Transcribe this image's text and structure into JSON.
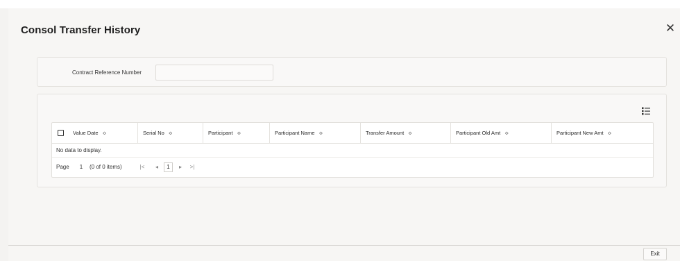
{
  "title": "Consol Transfer History",
  "close_icon": "close-icon",
  "contract": {
    "label": "Contract Reference Number",
    "value": ""
  },
  "grid": {
    "columns": [
      "Value Date",
      "Serial No",
      "Participant",
      "Participant Name",
      "Transfer Amount",
      "Participant Old Amt",
      "Participant New Amt"
    ],
    "no_data": "No data to display.",
    "pager": {
      "page_label": "Page",
      "page_value": "1",
      "items_info": "(0 of 0 items)",
      "current_page": "1",
      "first_icon": "first-page-icon",
      "prev_icon": "prev-page-icon",
      "next_icon": "next-page-icon",
      "last_icon": "last-page-icon"
    }
  },
  "footer": {
    "exit_label": "Exit"
  }
}
